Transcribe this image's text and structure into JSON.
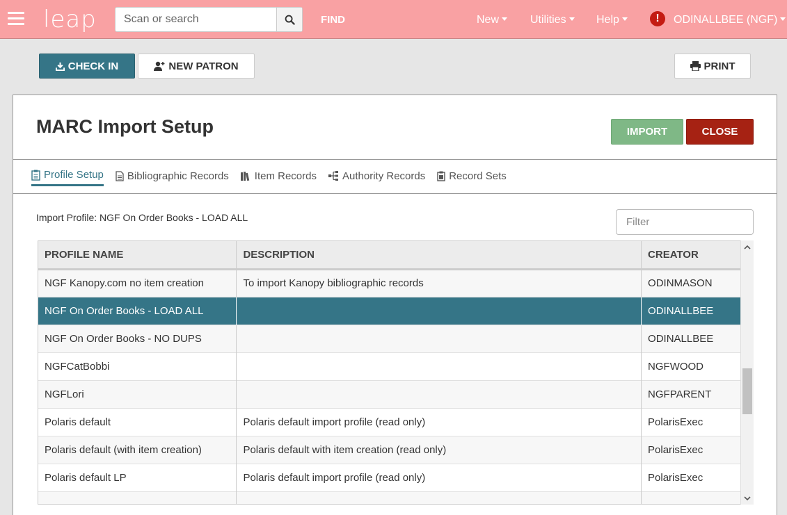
{
  "navbar": {
    "logo": "leap",
    "search_placeholder": "Scan or search",
    "find_label": "FIND",
    "menus": [
      "New",
      "Utilities",
      "Help"
    ],
    "user": "ODINALLBEE (NGF)",
    "alert_glyph": "!"
  },
  "actions": {
    "checkin": "CHECK IN",
    "new_patron": "NEW PATRON",
    "print": "PRINT"
  },
  "panel": {
    "title": "MARC Import Setup",
    "import_label": "IMPORT",
    "close_label": "CLOSE",
    "tabs": [
      {
        "label": "Profile Setup",
        "icon": "clipboard-icon",
        "active": true
      },
      {
        "label": "Bibliographic Records",
        "icon": "document-icon",
        "active": false
      },
      {
        "label": "Item Records",
        "icon": "books-icon",
        "active": false
      },
      {
        "label": "Authority Records",
        "icon": "sitemap-icon",
        "active": false
      },
      {
        "label": "Record Sets",
        "icon": "clipboard-stack-icon",
        "active": false
      }
    ],
    "import_profile": "Import Profile: NGF On Order Books - LOAD ALL",
    "filter_placeholder": "Filter"
  },
  "table": {
    "headers": [
      "PROFILE NAME",
      "DESCRIPTION",
      "CREATOR"
    ],
    "rows": [
      {
        "name": "NGF Kanopy.com no item creation",
        "description": "To import Kanopy bibliographic records",
        "creator": "ODINMASON"
      },
      {
        "name": "NGF On Order Books - LOAD ALL",
        "description": "",
        "creator": "ODINALLBEE",
        "selected": true
      },
      {
        "name": "NGF On Order Books - NO DUPS",
        "description": "",
        "creator": "ODINALLBEE"
      },
      {
        "name": "NGFCatBobbi",
        "description": "",
        "creator": "NGFWOOD"
      },
      {
        "name": "NGFLori",
        "description": "",
        "creator": "NGFPARENT"
      },
      {
        "name": "Polaris default",
        "description": "Polaris default import profile (read only)",
        "creator": "PolarisExec"
      },
      {
        "name": "Polaris default (with item creation)",
        "description": "Polaris default with item creation (read only)",
        "creator": "PolarisExec"
      },
      {
        "name": "Polaris default LP",
        "description": "Polaris default import profile (read only)",
        "creator": "PolarisExec"
      },
      {
        "name": "",
        "description": "",
        "creator": ""
      }
    ]
  },
  "colors": {
    "navbar": "#f9a1a3",
    "accent": "#357587",
    "import": "#7fb886",
    "close": "#a62213"
  }
}
